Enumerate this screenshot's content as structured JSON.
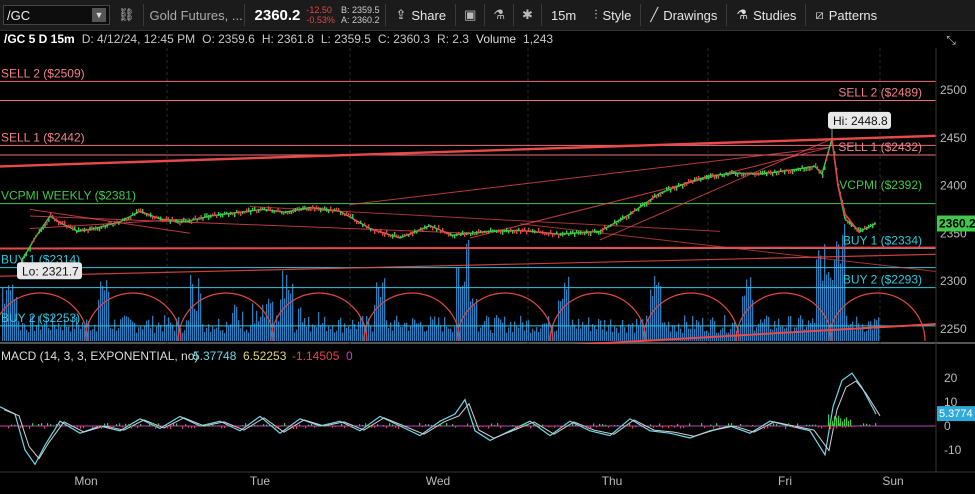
{
  "toolbar": {
    "symbol": "/GC",
    "description": "Gold Futures, ...",
    "last_price": "2360.2",
    "change": "-12.50",
    "change_pct": "-0.53%",
    "bid": "B: 2359.5",
    "ask": "A: 2360.2",
    "share": "Share",
    "interval": "15m",
    "style": "Style",
    "drawings": "Drawings",
    "studies": "Studies",
    "patterns": "Patterns"
  },
  "infobar": {
    "symbol": "/GC 5 D 15m",
    "date": "D: 4/12/24, 12:45 PM",
    "open": "O: 2359.6",
    "high": "H: 2361.8",
    "low": "L: 2359.5",
    "close": "C: 2360.3",
    "range": "R: 2.3",
    "volume_label": "Volume",
    "volume_value": "1,243"
  },
  "price_axis": {
    "ticks": [
      "2500",
      "2450",
      "2400",
      "2350",
      "2300",
      "2250"
    ],
    "current_label": "2360.2"
  },
  "levels": [
    {
      "label": "SELL 2 ($2509)",
      "side": "left",
      "price": 2509,
      "color": "#f0808b"
    },
    {
      "label": "SELL 1 ($2442)",
      "side": "left",
      "price": 2442,
      "color": "#f0808b"
    },
    {
      "label": "VCPMI WEEKLY ($2381)",
      "side": "left",
      "price": 2381,
      "color": "#3fc84a"
    },
    {
      "label": "BUY 1 ($2314)",
      "side": "left",
      "price": 2314,
      "color": "#2fc8dd"
    },
    {
      "label": "BUY 2 ($2253)",
      "side": "left",
      "price": 2253,
      "color": "#2fc8dd"
    },
    {
      "label": "SELL 2 ($2489)",
      "side": "right",
      "price": 2489,
      "color": "#f0808b"
    },
    {
      "label": "SELL 1 ($2432)",
      "side": "right",
      "price": 2432,
      "color": "#f0808b"
    },
    {
      "label": "VCPMI ($2392)",
      "side": "right",
      "price": 2392,
      "color": "#3fc84a"
    },
    {
      "label": "BUY 1 ($2334)",
      "side": "right",
      "price": 2334,
      "color": "#2fc8dd"
    },
    {
      "label": "BUY 2 ($2293)",
      "side": "right",
      "price": 2293,
      "color": "#2fc8dd"
    }
  ],
  "annotations": {
    "high": "Hi: 2448.8",
    "low": "Lo: 2321.7"
  },
  "macd": {
    "label": "MACD (14, 3, 3, EXPONENTIAL, no)",
    "value": "5.37748",
    "avg": "6.52253",
    "diff": "-1.14505",
    "zero": "0",
    "ticks": [
      "20",
      "10",
      "0",
      "-10"
    ],
    "current_label": "5.3774"
  },
  "time_axis": [
    "Mon",
    "Tue",
    "Wed",
    "Thu",
    "Fri",
    "Sun"
  ],
  "colors": {
    "background": "#000000",
    "candle_up": "#3fc84a",
    "candle_down": "#e04646",
    "volume": "#2f7ab8",
    "macd_line": "#6fd6e8",
    "macd_avg": "#d0d0d0",
    "trendline": "#e84a4a"
  },
  "chart_data": {
    "type": "line",
    "title": "/GC 5 D 15m",
    "ylim": [
      2225,
      2525
    ],
    "x": [
      "Mon",
      "Tue",
      "Wed",
      "Thu",
      "Fri"
    ],
    "series": [
      {
        "name": "/GC",
        "values": [
          2321.7,
          2345,
          2368,
          2360,
          2352,
          2355,
          2362,
          2373,
          2365,
          2362,
          2368,
          2372,
          2375,
          2372,
          2377,
          2373,
          2355,
          2345,
          2358,
          2348,
          2350,
          2352,
          2353,
          2349,
          2352,
          2370,
          2392,
          2404,
          2410,
          2413,
          2412,
          2416,
          2420,
          2412,
          2448.8,
          2400,
          2365,
          2352,
          2360.2
        ]
      }
    ]
  }
}
